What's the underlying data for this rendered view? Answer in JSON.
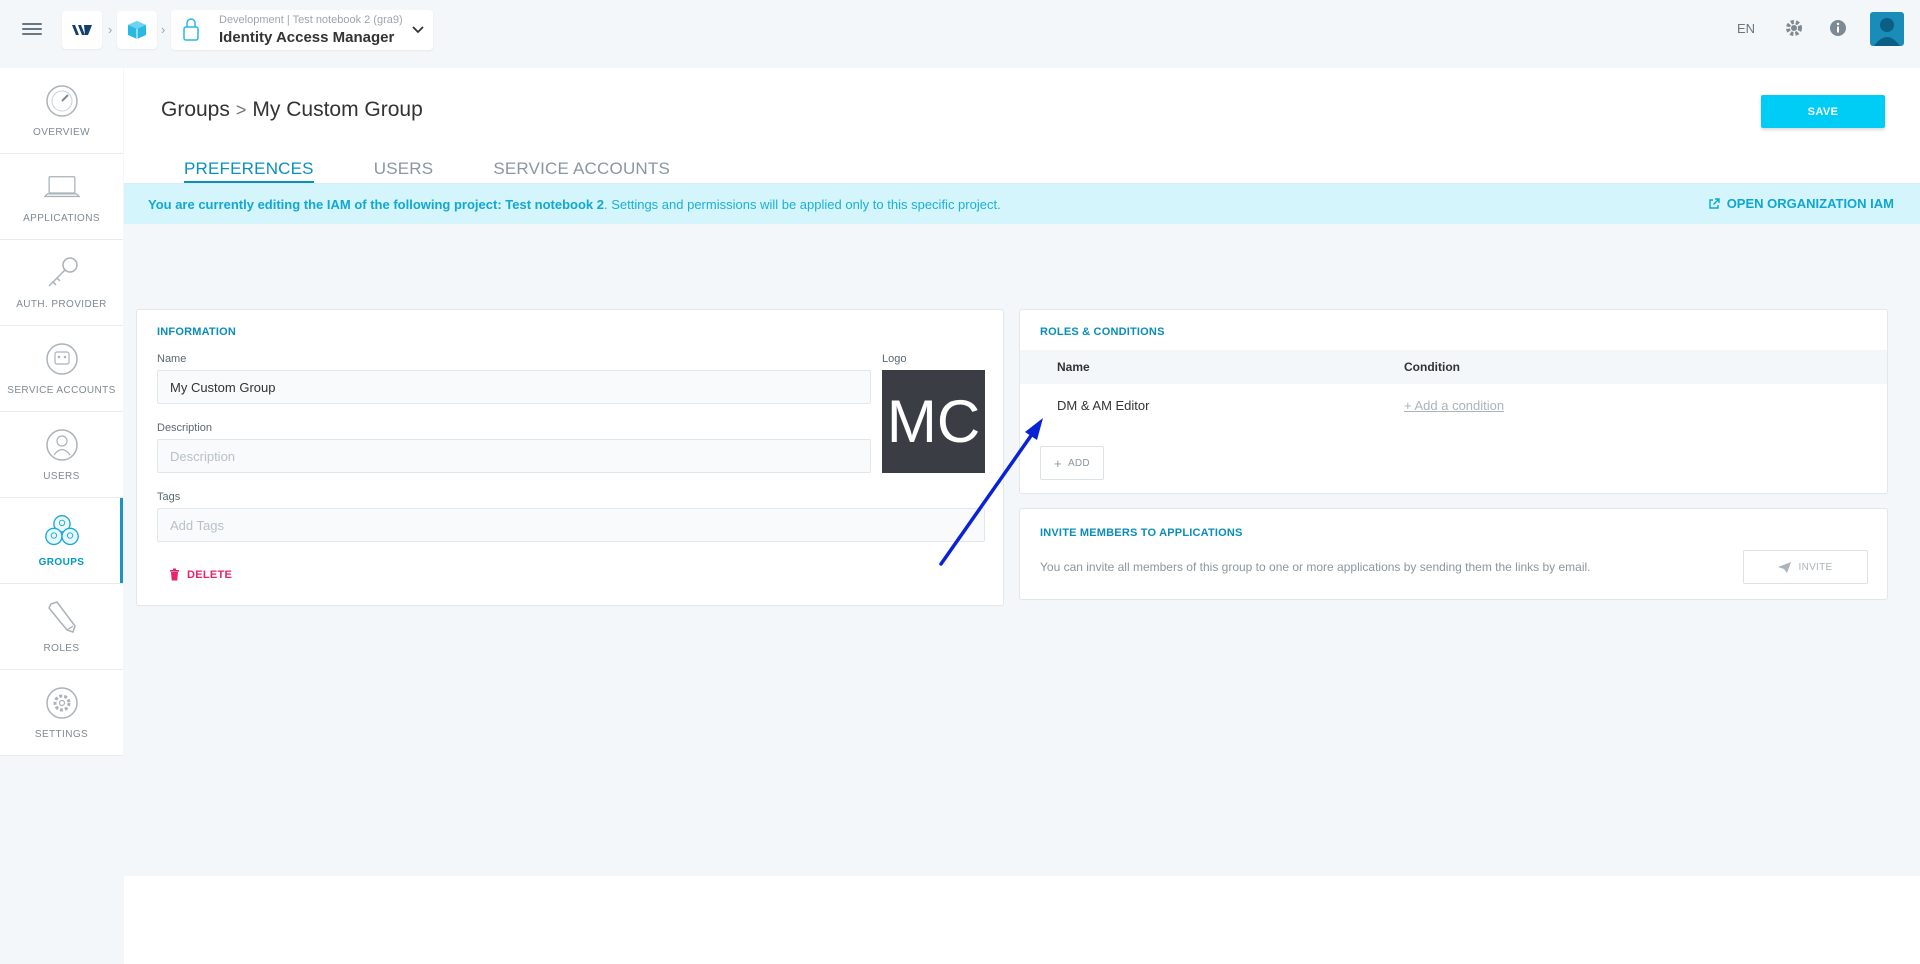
{
  "header": {
    "app_env": "Development | Test notebook 2 (gra9)",
    "app_name": "Identity Access Manager",
    "language": "EN"
  },
  "sidebar": {
    "items": [
      {
        "label": "OVERVIEW",
        "icon": "speedometer-icon"
      },
      {
        "label": "APPLICATIONS",
        "icon": "laptop-icon"
      },
      {
        "label": "AUTH. PROVIDER",
        "icon": "key-icon"
      },
      {
        "label": "SERVICE ACCOUNTS",
        "icon": "robot-icon"
      },
      {
        "label": "USERS",
        "icon": "user-icon"
      },
      {
        "label": "GROUPS",
        "icon": "group-icon",
        "active": true
      },
      {
        "label": "ROLES",
        "icon": "pencil-icon"
      },
      {
        "label": "SETTINGS",
        "icon": "gear-icon"
      }
    ]
  },
  "page": {
    "breadcrumb_root": "Groups",
    "breadcrumb_current": "My Custom Group",
    "save_label": "SAVE"
  },
  "tabs": [
    {
      "label": "PREFERENCES",
      "active": true
    },
    {
      "label": "USERS",
      "active": false
    },
    {
      "label": "SERVICE ACCOUNTS",
      "active": false
    }
  ],
  "banner": {
    "prefix": "You are currently editing the IAM of the following project: Test notebook 2",
    "suffix": ". Settings and permissions will be applied only to this specific project.",
    "link_label": "OPEN ORGANIZATION IAM"
  },
  "information": {
    "title": "INFORMATION",
    "name_label": "Name",
    "name_value": "My Custom Group",
    "logo_label": "Logo",
    "logo_initials": "MC",
    "description_label": "Description",
    "description_placeholder": "Description",
    "tags_label": "Tags",
    "tags_placeholder": "Add Tags",
    "delete_label": "DELETE"
  },
  "roles": {
    "title": "ROLES & CONDITIONS",
    "col_name": "Name",
    "col_condition": "Condition",
    "rows": [
      {
        "name": "DM & AM Editor",
        "condition": "+ Add a condition"
      }
    ],
    "add_label": "ADD"
  },
  "invite": {
    "title": "INVITE MEMBERS TO APPLICATIONS",
    "description": "You can invite all members of this group to one or more applications by sending them the links by email.",
    "button_label": "INVITE"
  },
  "colors": {
    "accent": "#00cdf5",
    "primary_text": "#0a8cbc",
    "danger": "#e8226b",
    "banner_bg": "#d3f5fb",
    "annotation_arrow": "#0a22d6"
  }
}
